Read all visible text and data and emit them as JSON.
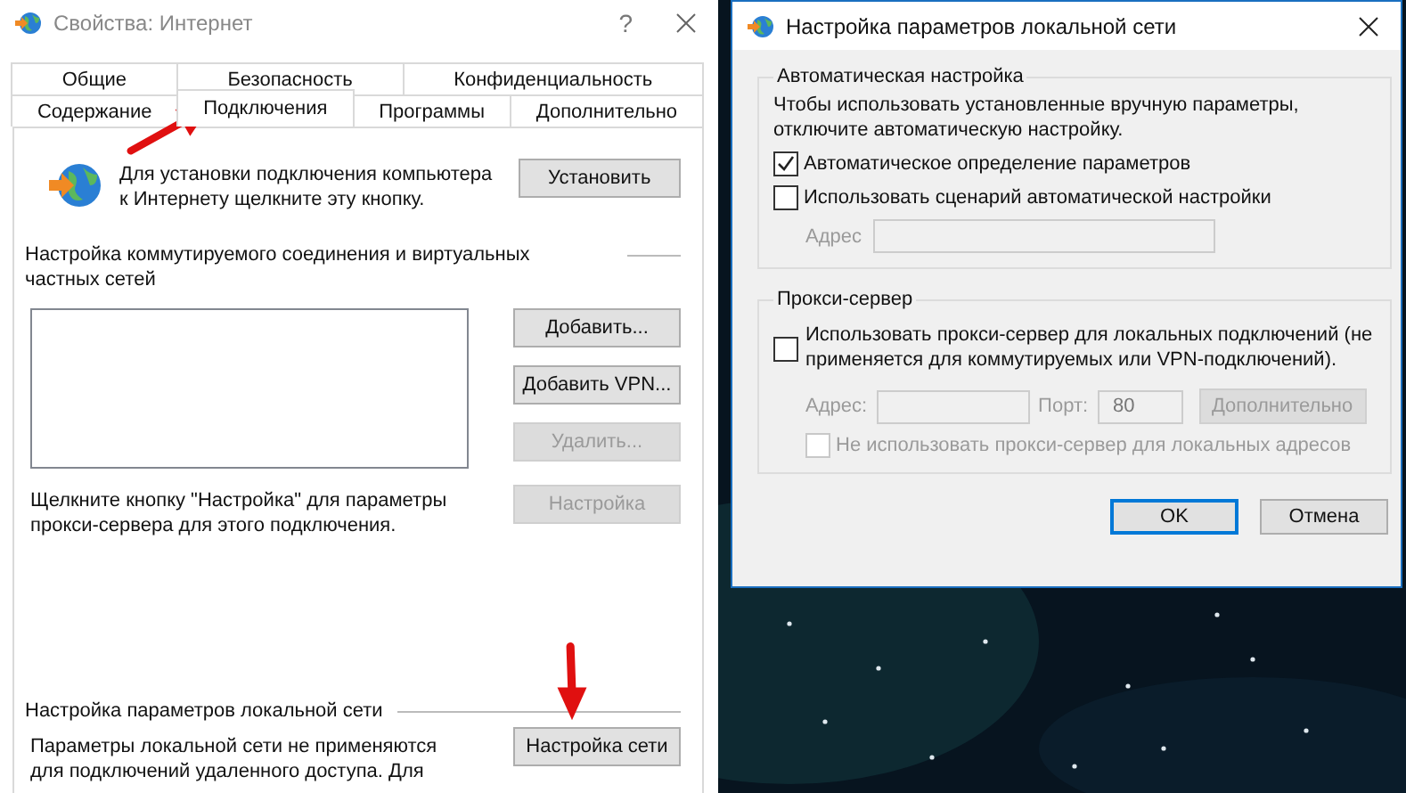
{
  "internet_properties": {
    "title": "Свойства: Интернет",
    "help_button": "?",
    "tab_rows": [
      [
        {
          "label": "Общие",
          "selected": false
        },
        {
          "label": "Безопасность",
          "selected": false
        },
        {
          "label": "Конфиденциальность",
          "selected": false
        }
      ],
      [
        {
          "label": "Содержание",
          "selected": false
        },
        {
          "label": "Подключения",
          "selected": true
        },
        {
          "label": "Программы",
          "selected": false
        },
        {
          "label": "Дополнительно",
          "selected": false
        }
      ]
    ],
    "setup": {
      "text": "Для установки подключения компьютера к Интернету щелкните эту кнопку.",
      "button": "Установить"
    },
    "dialup": {
      "title": "Настройка коммутируемого соединения и виртуальных частных сетей",
      "buttons": [
        {
          "label": "Добавить...",
          "disabled": false
        },
        {
          "label": "Добавить VPN...",
          "disabled": false
        },
        {
          "label": "Удалить...",
          "disabled": true
        },
        {
          "label": "Настройка",
          "disabled": true
        }
      ],
      "hint": "Щелкните кнопку \"Настройка\" для параметры прокси-сервера для этого подключения."
    },
    "lan": {
      "title": "Настройка параметров локальной сети",
      "text": "Параметры локальной сети не применяются для подключений удаленного доступа. Для",
      "button": "Настройка сети"
    }
  },
  "lan_dialog": {
    "title": "Настройка параметров локальной сети",
    "auto": {
      "title": "Автоматическая настройка",
      "text": "Чтобы использовать установленные вручную параметры, отключите автоматическую настройку.",
      "options": [
        {
          "label": "Автоматическое определение параметров",
          "checked": true
        },
        {
          "label": "Использовать сценарий автоматической настройки",
          "checked": false
        }
      ],
      "address": {
        "label": "Адрес",
        "disabled": true
      }
    },
    "proxy": {
      "title": "Прокси-сервер",
      "use_proxy": {
        "label": "Использовать прокси-сервер для локальных подключений (не применяется для коммутируемых или VPN-подключений).",
        "checked": false
      },
      "disabled": true,
      "address_label": "Адрес:",
      "port_label": "Порт:",
      "port_value": "80",
      "advanced_button": "Дополнительно",
      "bypass": {
        "label": "Не использовать прокси-сервер для локальных адресов",
        "checked": false
      }
    },
    "buttons": [
      {
        "label": "OK",
        "default": true
      },
      {
        "label": "Отмена",
        "default": false
      }
    ]
  }
}
